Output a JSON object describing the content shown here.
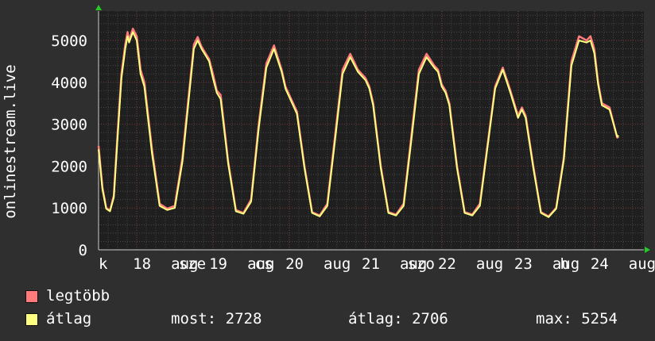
{
  "chart_data": {
    "type": "line",
    "ylabel": "onlinestream.live",
    "ylim": [
      0,
      5700
    ],
    "yticks": [
      0,
      1000,
      2000,
      3000,
      4000,
      5000
    ],
    "xlim": [
      0,
      7.15
    ],
    "xticks": [
      {
        "at": 0.0,
        "label": "k"
      },
      {
        "at": 0.45,
        "label": "18"
      },
      {
        "at": 0.95,
        "label": "aug"
      },
      {
        "at": 1.05,
        "label": "sze"
      },
      {
        "at": 1.45,
        "label": "19"
      },
      {
        "at": 1.95,
        "label": "aug"
      },
      {
        "at": 2.05,
        "label": "cs"
      },
      {
        "at": 2.45,
        "label": "20"
      },
      {
        "at": 2.95,
        "label": "aug"
      },
      {
        "at": 3.45,
        "label": "21"
      },
      {
        "at": 3.95,
        "label": "aug"
      },
      {
        "at": 4.05,
        "label": "szo"
      },
      {
        "at": 4.45,
        "label": "22"
      },
      {
        "at": 4.95,
        "label": "aug"
      },
      {
        "at": 5.45,
        "label": "23"
      },
      {
        "at": 5.95,
        "label": "aug"
      },
      {
        "at": 6.05,
        "label": "h"
      },
      {
        "at": 6.45,
        "label": "24"
      },
      {
        "at": 6.95,
        "label": "aug"
      }
    ],
    "grid": true,
    "series": [
      {
        "name": "legtöbb",
        "color": "#ff7b7b",
        "x": [
          0.0,
          0.05,
          0.1,
          0.15,
          0.2,
          0.25,
          0.3,
          0.35,
          0.38,
          0.4,
          0.45,
          0.5,
          0.55,
          0.6,
          0.7,
          0.8,
          0.9,
          1.0,
          1.1,
          1.2,
          1.25,
          1.3,
          1.35,
          1.4,
          1.45,
          1.5,
          1.55,
          1.6,
          1.7,
          1.8,
          1.9,
          2.0,
          2.1,
          2.2,
          2.3,
          2.4,
          2.45,
          2.5,
          2.55,
          2.6,
          2.7,
          2.8,
          2.9,
          3.0,
          3.1,
          3.2,
          3.3,
          3.4,
          3.45,
          3.5,
          3.55,
          3.6,
          3.7,
          3.8,
          3.9,
          4.0,
          4.1,
          4.2,
          4.3,
          4.4,
          4.45,
          4.5,
          4.55,
          4.6,
          4.7,
          4.8,
          4.9,
          5.0,
          5.1,
          5.2,
          5.3,
          5.4,
          5.45,
          5.5,
          5.55,
          5.6,
          5.7,
          5.8,
          5.9,
          6.0,
          6.1,
          6.2,
          6.3,
          6.4,
          6.45,
          6.5,
          6.55,
          6.6,
          6.7,
          6.8,
          6.82
        ],
        "y": [
          2480,
          1500,
          1000,
          940,
          1300,
          2800,
          4200,
          4900,
          5200,
          5000,
          5280,
          5100,
          4300,
          4000,
          2400,
          1100,
          980,
          1050,
          2200,
          4000,
          4900,
          5080,
          4850,
          4700,
          4550,
          4200,
          3800,
          3700,
          2100,
          950,
          880,
          1200,
          3000,
          4450,
          4880,
          4300,
          3900,
          3700,
          3500,
          3300,
          2000,
          900,
          820,
          1100,
          2700,
          4300,
          4680,
          4300,
          4200,
          4100,
          3900,
          3500,
          2000,
          900,
          840,
          1100,
          2700,
          4300,
          4680,
          4400,
          4300,
          3950,
          3800,
          3500,
          2000,
          900,
          840,
          1100,
          2500,
          3900,
          4350,
          3800,
          3500,
          3200,
          3400,
          3200,
          2000,
          900,
          800,
          1000,
          2200,
          4500,
          5100,
          5000,
          5100,
          4800,
          4000,
          3500,
          3400,
          2680,
          2700
        ]
      },
      {
        "name": "átlag",
        "color": "#ffff80",
        "x": [
          0.0,
          0.05,
          0.1,
          0.15,
          0.2,
          0.25,
          0.3,
          0.35,
          0.38,
          0.4,
          0.45,
          0.5,
          0.55,
          0.6,
          0.7,
          0.8,
          0.9,
          1.0,
          1.1,
          1.2,
          1.25,
          1.3,
          1.35,
          1.4,
          1.45,
          1.5,
          1.55,
          1.6,
          1.7,
          1.8,
          1.9,
          2.0,
          2.1,
          2.2,
          2.3,
          2.4,
          2.45,
          2.5,
          2.55,
          2.6,
          2.7,
          2.8,
          2.9,
          3.0,
          3.1,
          3.2,
          3.3,
          3.4,
          3.45,
          3.5,
          3.55,
          3.6,
          3.7,
          3.8,
          3.9,
          4.0,
          4.1,
          4.2,
          4.3,
          4.4,
          4.45,
          4.5,
          4.55,
          4.6,
          4.7,
          4.8,
          4.9,
          5.0,
          5.1,
          5.2,
          5.3,
          5.4,
          5.45,
          5.5,
          5.55,
          5.6,
          5.7,
          5.8,
          5.9,
          6.0,
          6.1,
          6.2,
          6.3,
          6.4,
          6.45,
          6.5,
          6.55,
          6.6,
          6.7,
          6.8,
          6.82
        ],
        "y": [
          2400,
          1450,
          980,
          920,
          1250,
          2700,
          4100,
          4800,
          5100,
          4950,
          5200,
          5000,
          4200,
          3900,
          2300,
          1050,
          950,
          1000,
          2100,
          3900,
          4800,
          5000,
          4800,
          4650,
          4500,
          4100,
          3750,
          3600,
          2050,
          920,
          860,
          1150,
          2900,
          4350,
          4800,
          4250,
          3850,
          3650,
          3450,
          3250,
          1950,
          880,
          800,
          1050,
          2600,
          4200,
          4600,
          4250,
          4150,
          4050,
          3850,
          3450,
          1950,
          880,
          820,
          1050,
          2600,
          4200,
          4600,
          4350,
          4250,
          3900,
          3750,
          3450,
          1950,
          880,
          820,
          1050,
          2450,
          3850,
          4300,
          3750,
          3450,
          3150,
          3350,
          3150,
          1950,
          880,
          780,
          980,
          2150,
          4400,
          5000,
          4950,
          5000,
          4700,
          3950,
          3450,
          3350,
          2700,
          2728
        ]
      }
    ],
    "legend_position": "bottom-left"
  },
  "legend": {
    "items": [
      {
        "label": "legtöbb",
        "color": "#ff7b7b"
      },
      {
        "label": "átlag",
        "color": "#ffff80"
      }
    ]
  },
  "stats": {
    "now": "most: 2728",
    "avg": "átlag: 2706",
    "max": "max: 5254"
  }
}
